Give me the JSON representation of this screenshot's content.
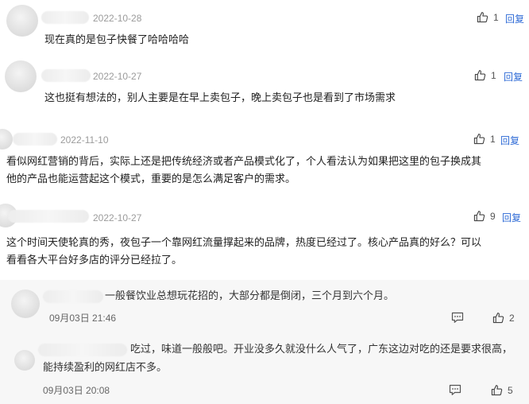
{
  "comments": [
    {
      "date": "2022-10-28",
      "likes": "1",
      "reply_label": "回复",
      "text": "现在真的是包子快餐了哈哈哈哈"
    },
    {
      "date": "2022-10-27",
      "likes": "1",
      "reply_label": "回复",
      "text": "这也挺有想法的，别人主要是在早上卖包子，晚上卖包子也是看到了市场需求"
    },
    {
      "date": "2022-11-10",
      "likes": "1",
      "reply_label": "回复",
      "text_line1": "看似网红营销的背后，实际上还是把传统经济或者产品模式化了，个人看法认为如果把这里的包子换成其",
      "text_line2": "他的产品也能运营起这个模式，重要的是怎么满足客户的需求。"
    },
    {
      "date": "2022-10-27",
      "likes": "9",
      "reply_label": "回复",
      "text_line1": "这个时间天使轮真的秀，夜包子一个靠网红流量撑起来的品牌，热度已经过了。核心产品真的好么？可以",
      "text_line2": "看看各大平台好多店的评分已经拉了。"
    }
  ],
  "sub_replies": [
    {
      "text": "一般餐饮业总想玩花招的，大部分都是倒闭，三个月到六个月。",
      "date": "09月03日 21:46",
      "likes": "2"
    },
    {
      "text_line1": "吃过，味道一般般吧。开业没多久就没什么人气了，广东这边对吃的还是要求很高，",
      "text_line2": "能持续盈利的网红店不多。",
      "date": "09月03日 20:08",
      "likes": "5"
    }
  ],
  "colors": {
    "reply_link": "#2f6bd6",
    "date_gray": "#9b9b9b",
    "sub_background": "#f7f7f7"
  }
}
